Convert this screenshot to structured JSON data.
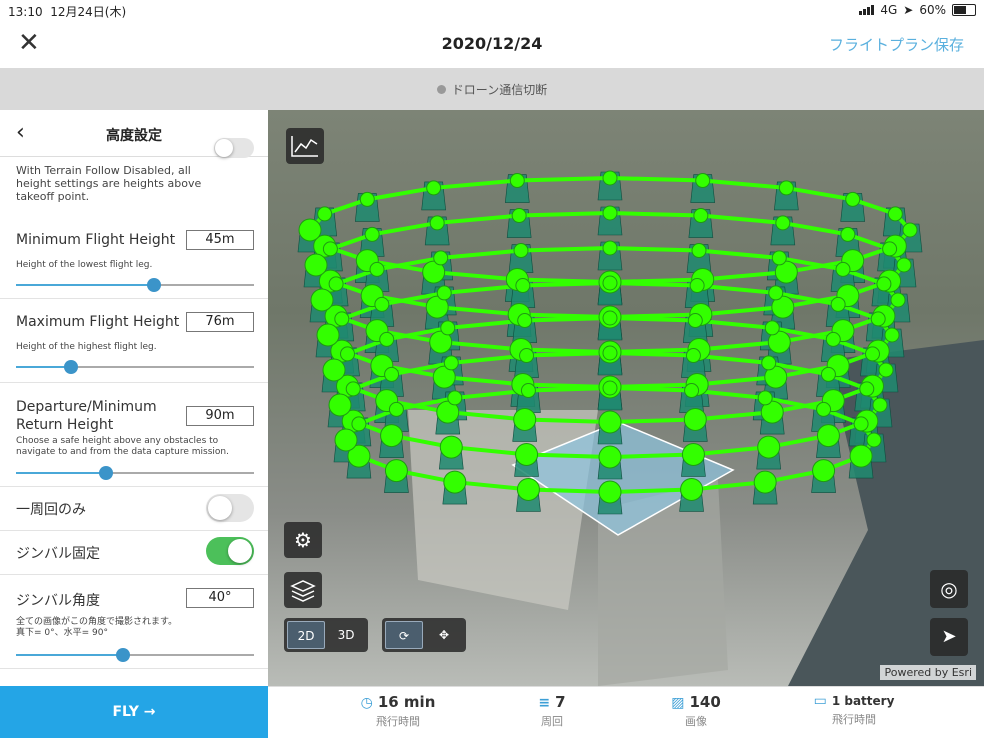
{
  "status": {
    "time": "13:10",
    "date": "12月24日(木)",
    "network": "4G",
    "battery": "60%"
  },
  "header": {
    "title": "2020/12/24",
    "save_label": "フライトプラン保存",
    "close_icon": "close-icon"
  },
  "connection": {
    "status_text": "ドローン通信切断"
  },
  "panel": {
    "title": "高度設定",
    "terrain_note": "With Terrain Follow Disabled, all height settings are heights above takeoff point.",
    "min_height": {
      "label": "Minimum Flight Height",
      "value": "45m",
      "help": "Height of the lowest flight leg.",
      "slider": 0.58
    },
    "max_height": {
      "label": "Maximum Flight Height",
      "value": "76m",
      "help": "Height of the highest flight leg.",
      "slider": 0.23
    },
    "departure": {
      "label": "Departure/Minimum Return Height",
      "value": "90m",
      "help": "Choose a safe height above any obstacles to navigate to and from the data capture mission.",
      "slider": 0.38
    },
    "single_lap": {
      "label": "一周回のみ",
      "on": false
    },
    "gimbal_lock": {
      "label": "ジンバル固定",
      "on": true
    },
    "gimbal_angle": {
      "label": "ジンバル角度",
      "value": "40°",
      "help1": "全ての画像がこの角度で撮影されます。",
      "help2": "真下= 0°、水平= 90°",
      "slider": 0.45
    },
    "fly_label": "FLY →"
  },
  "map": {
    "btn_2d": "2D",
    "btn_3d": "3D",
    "powered_by": "Powered by Esri",
    "mode": "2D"
  },
  "stats": [
    {
      "value": "16 min",
      "label": "飛行時間",
      "icon": "clock-icon"
    },
    {
      "value": "7",
      "label": "周回",
      "icon": "laps-icon"
    },
    {
      "value": "140",
      "label": "画像",
      "icon": "image-icon"
    },
    {
      "value": "1 battery",
      "label": "飛行時間",
      "icon": "battery-icon"
    }
  ],
  "colors": {
    "accent": "#24a5e6",
    "toggle_on": "#4cc05a",
    "path": "#33ff00",
    "camera": "#1f8a70"
  }
}
